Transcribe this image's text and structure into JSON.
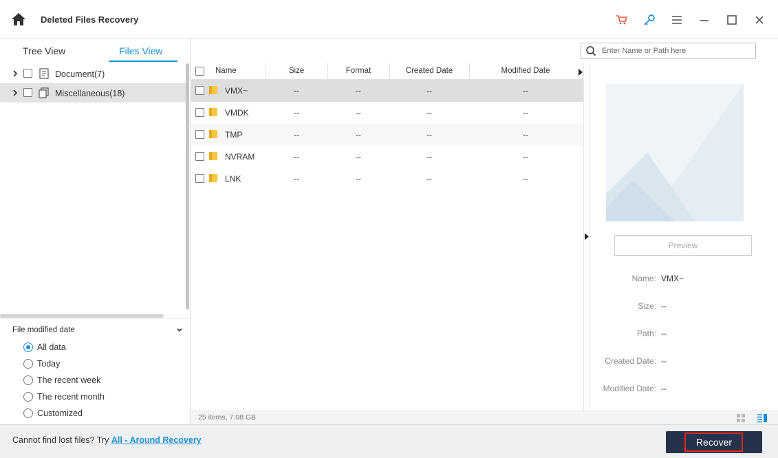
{
  "app": {
    "title": "Deleted Files Recovery",
    "title_bar_icons": [
      "cart-icon",
      "key-icon",
      "menu-icon",
      "minimize-icon",
      "maximize-icon",
      "close-icon"
    ],
    "accent_color": "#1a8fd6",
    "cart_color": "#e8563a"
  },
  "tabs": [
    {
      "label": "Tree View",
      "active": false
    },
    {
      "label": "Files View",
      "active": true
    }
  ],
  "search": {
    "placeholder": "Enter Name or Path here",
    "value": ""
  },
  "sidebar": {
    "items": [
      {
        "label": "Document(7)",
        "icon": "document-icon",
        "selected": false
      },
      {
        "label": "Miscellaneous(18)",
        "icon": "misc-icon",
        "selected": true
      }
    ]
  },
  "filter": {
    "title": "File modified date",
    "options": [
      "All data",
      "Today",
      "The recent week",
      "The recent month",
      "Customized"
    ],
    "selected": "All data"
  },
  "table": {
    "columns": [
      "Name",
      "Size",
      "Format",
      "Created Date",
      "Modified Date"
    ],
    "rows": [
      {
        "name": "VMX~",
        "size": "--",
        "format": "--",
        "created": "--",
        "modified": "--"
      },
      {
        "name": "VMDK",
        "size": "--",
        "format": "--",
        "created": "--",
        "modified": "--"
      },
      {
        "name": "TMP",
        "size": "--",
        "format": "--",
        "created": "--",
        "modified": "--"
      },
      {
        "name": "NVRAM",
        "size": "--",
        "format": "--",
        "created": "--",
        "modified": "--"
      },
      {
        "name": "LNK",
        "size": "--",
        "format": "--",
        "created": "--",
        "modified": "--"
      }
    ]
  },
  "status": {
    "summary": "25 items, 7.08 GB"
  },
  "preview": {
    "button_label": "Preview",
    "fields": [
      {
        "label": "Name:",
        "value": "VMX~"
      },
      {
        "label": "Size:",
        "value": "--"
      },
      {
        "label": "Path:",
        "value": "--"
      },
      {
        "label": "Created Date:",
        "value": "--"
      },
      {
        "label": "Modified Date:",
        "value": "--"
      }
    ]
  },
  "footer": {
    "prompt": "Cannot find lost files? Try ",
    "link": "All - Around Recovery",
    "recover_label": "Recover",
    "recover_color": "#263249",
    "highlight_color": "#e0281f"
  }
}
